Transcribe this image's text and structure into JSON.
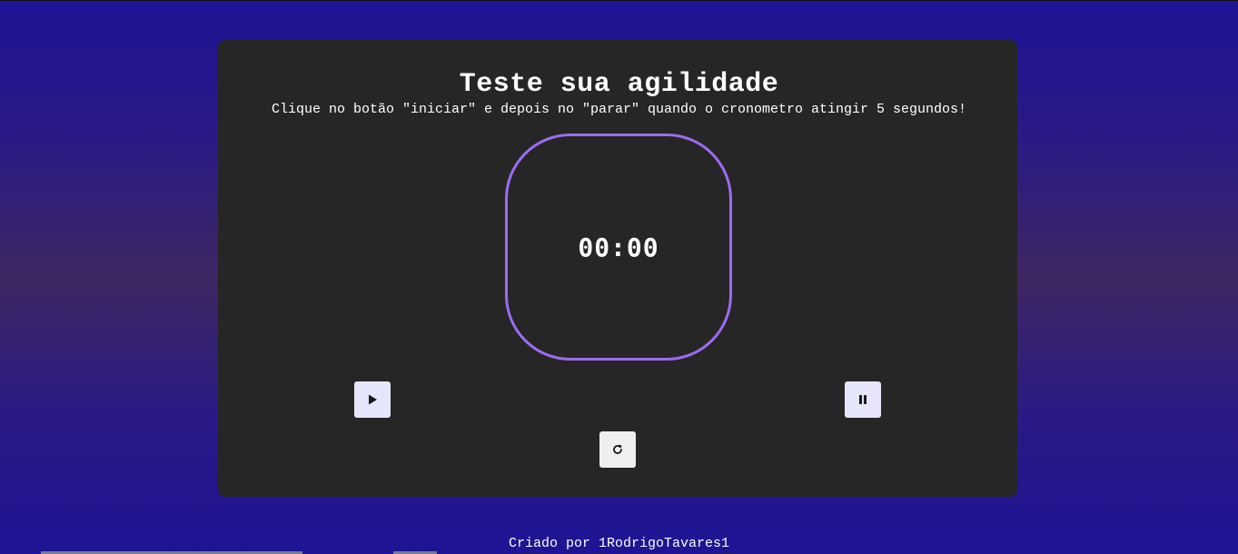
{
  "header": {
    "title": "Teste sua agilidade",
    "subtitle": "Clique no botão \"iniciar\" e depois no \"parar\" quando o cronometro atingir 5 segundos!"
  },
  "timer": {
    "display": "00:00",
    "border_color": "#9b6cf0"
  },
  "controls": {
    "start_icon": "play-icon",
    "stop_icon": "pause-icon",
    "reset_icon": "reset-icon"
  },
  "footer": {
    "credit": "Criado por 1RodrigoTavares1"
  },
  "colors": {
    "card_background": "#262626",
    "page_background": "#1e1494",
    "button_background": "#e6e6fb"
  }
}
